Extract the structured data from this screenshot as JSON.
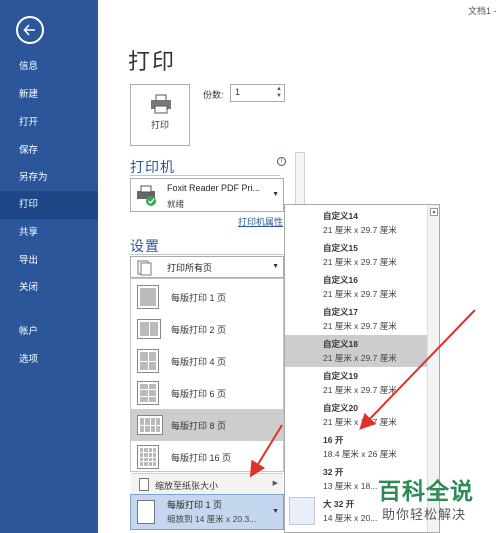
{
  "window": {
    "title": "文档1 -"
  },
  "sidebar": {
    "items": [
      {
        "label": "信息"
      },
      {
        "label": "新建"
      },
      {
        "label": "打开"
      },
      {
        "label": "保存"
      },
      {
        "label": "另存为"
      },
      {
        "label": "打印"
      },
      {
        "label": "共享"
      },
      {
        "label": "导出"
      },
      {
        "label": "关闭"
      },
      {
        "label": "帐户"
      },
      {
        "label": "选项"
      }
    ],
    "active": "打印"
  },
  "page": {
    "title": "打印"
  },
  "print": {
    "button_label": "打印",
    "copies_label": "份数:",
    "copies_value": "1"
  },
  "printer": {
    "section": "打印机",
    "name": "Foxit Reader PDF Pri...",
    "status": "就绪",
    "properties_link": "打印机属性"
  },
  "settings": {
    "section": "设置",
    "scope": "打印所有页",
    "pages_per_sheet": [
      {
        "label": "每版打印 1 页"
      },
      {
        "label": "每版打印 2 页"
      },
      {
        "label": "每版打印 4 页"
      },
      {
        "label": "每版打印 6 页"
      },
      {
        "label": "每版打印 8 页",
        "selected": true
      },
      {
        "label": "每版打印 16 页"
      }
    ],
    "scale_to_paper": "缩放至纸张大小",
    "current": {
      "line1": "每版打印 1 页",
      "line2": "缩放到 14 厘米 x 20.3..."
    }
  },
  "paper_sizes": [
    {
      "name": "自定义14",
      "dims": "21 厘米 x 29.7 厘米"
    },
    {
      "name": "自定义15",
      "dims": "21 厘米 x 29.7 厘米"
    },
    {
      "name": "自定义16",
      "dims": "21 厘米 x 29.7 厘米"
    },
    {
      "name": "自定义17",
      "dims": "21 厘米 x 29.7 厘米"
    },
    {
      "name": "自定义18",
      "dims": "21 厘米 x 29.7 厘米",
      "selected": true
    },
    {
      "name": "自定义19",
      "dims": "21 厘米 x 29.7 厘米"
    },
    {
      "name": "自定义20",
      "dims": "21 厘米 x 29.7 厘米"
    },
    {
      "name": "16 开",
      "dims": "18.4 厘米 x 26 厘米"
    },
    {
      "name": "32 开",
      "dims": "13 厘米 x 18..."
    },
    {
      "name": "大 32 开",
      "dims": "14 厘米 x 20..."
    }
  ],
  "watermark": {
    "brand": "百科全说",
    "tagline": "助你轻松解决"
  },
  "colors": {
    "sidebar": "#2b579a",
    "accent": "#2b579a",
    "arrow": "#e0322d"
  }
}
